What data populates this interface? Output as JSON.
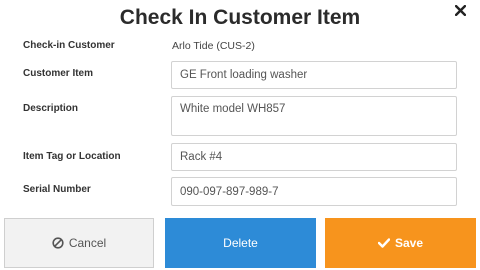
{
  "dialog": {
    "title": "Check In Customer Item",
    "close_icon": "close-icon"
  },
  "form": {
    "checkin_customer": {
      "label": "Check-in Customer",
      "value": "Arlo Tide (CUS-2)"
    },
    "customer_item": {
      "label": "Customer Item",
      "value": "GE Front loading washer"
    },
    "description": {
      "label": "Description",
      "value": "White model WH857"
    },
    "item_tag": {
      "label": "Item Tag or Location",
      "value": "Rack #4"
    },
    "serial_number": {
      "label": "Serial Number",
      "value": "090-097-897-989-7"
    }
  },
  "buttons": {
    "cancel": {
      "label": "Cancel",
      "icon": "ban-icon"
    },
    "delete": {
      "label": "Delete"
    },
    "save": {
      "label": "Save",
      "icon": "check-icon"
    }
  },
  "colors": {
    "delete_bg": "#2d8bd7",
    "save_bg": "#f7941d",
    "cancel_bg": "#f2f2f2"
  }
}
